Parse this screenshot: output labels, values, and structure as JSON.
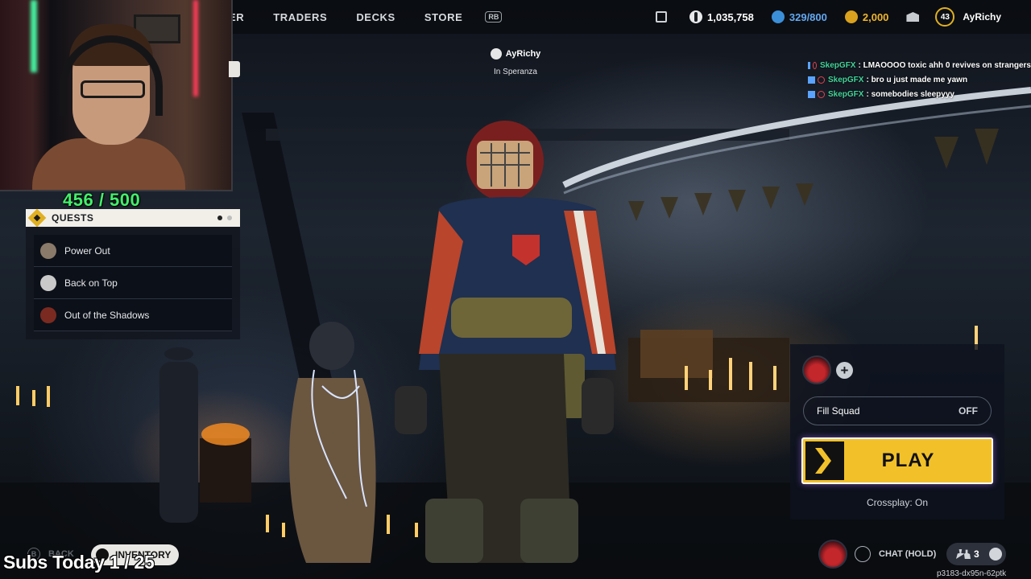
{
  "nav": {
    "tabs": [
      "ER",
      "TRADERS",
      "DECKS",
      "STORE"
    ],
    "bumper": "RB"
  },
  "currencies": {
    "cod_points": "1,035,758",
    "blue_currency": "329/800",
    "gold_currency": "2,000",
    "level": "43",
    "username": "AyRichy",
    "accent_blue": "#64a8f0",
    "accent_gold": "#f0b62a"
  },
  "overlay": {
    "sub_goal": "456 / 500",
    "subs_today": "Subs Today 1 / 25"
  },
  "quests": {
    "title": "QUESTS",
    "items": [
      {
        "label": "Power Out",
        "avatar_color": "#8a7a6a"
      },
      {
        "label": "Back on Top",
        "avatar_color": "#c9c9c9"
      },
      {
        "label": "Out of the Shadows",
        "avatar_color": "#7a2a20"
      }
    ]
  },
  "player": {
    "name": "AyRichy",
    "location": "In Speranza"
  },
  "chat": [
    {
      "user": "SkepGFX",
      "message": ": LMAOOOO toxic ahh 0 revives on strangers"
    },
    {
      "user": "SkepGFX",
      "message": ": bro u just made me yawn"
    },
    {
      "user": "SkepGFX",
      "message": ": somebodies sleepyyy"
    }
  ],
  "play_panel": {
    "fill_squad_label": "Fill Squad",
    "fill_squad_value": "OFF",
    "play_label": "PLAY",
    "crossplay": "Crossplay: On",
    "play_color": "#f2c12a"
  },
  "bottom": {
    "back_key": "B",
    "back_label": "BACK",
    "inventory_label": "INVENTORY",
    "chat_label": "CHAT (HOLD)",
    "party_count": "3",
    "session_id": "p3183-dx95n-62ptk"
  }
}
